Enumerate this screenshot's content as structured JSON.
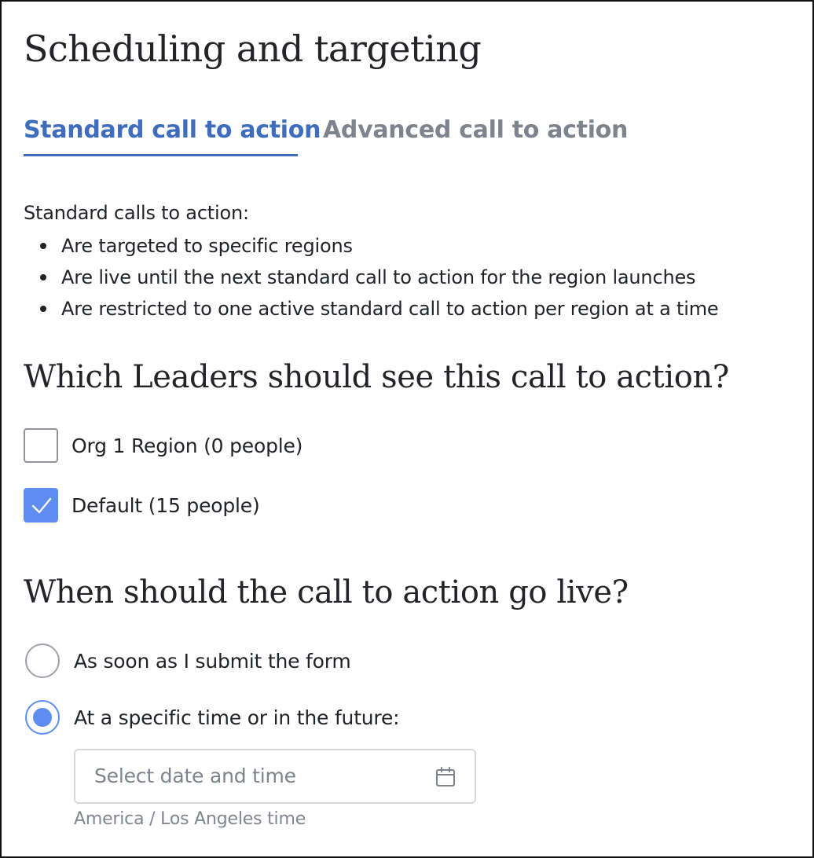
{
  "page": {
    "title": "Scheduling and targeting"
  },
  "tabs": [
    {
      "label": "Standard call to action",
      "active": true
    },
    {
      "label": "Advanced call to action",
      "active": false
    }
  ],
  "intro": {
    "lead": "Standard calls to action:",
    "bullets": [
      "Are targeted to specific regions",
      "Are live until the next standard call to action for the region launches",
      "Are restricted to one active standard call to action per region at a time"
    ]
  },
  "leaders": {
    "heading": "Which Leaders should see this call to action?",
    "options": [
      {
        "label": "Org 1 Region (0 people)",
        "checked": false
      },
      {
        "label": "Default (15 people)",
        "checked": true
      }
    ]
  },
  "schedule": {
    "heading": "When should the call to action go live?",
    "options": [
      {
        "label": "As soon as I submit the form",
        "selected": false
      },
      {
        "label": "At a specific time or in the future:",
        "selected": true
      }
    ],
    "date_input": {
      "placeholder": "Select date and time",
      "value": "",
      "icon": "calendar-icon"
    },
    "timezone_note": "America / Los Angeles time"
  },
  "colors": {
    "accent": "#3f6cbc",
    "control_fill": "#5e8df0",
    "inactive_tab": "#7e838d",
    "muted_text": "#80858e"
  }
}
